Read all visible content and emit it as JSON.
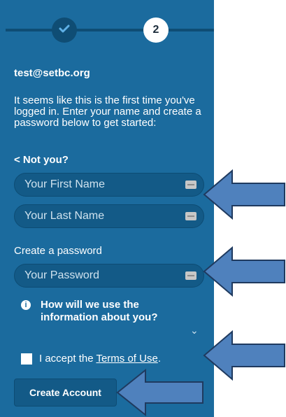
{
  "stepper": {
    "step1_icon": "check-icon",
    "step2_number": "2"
  },
  "account": {
    "email": "test@setbc.org",
    "intro": "It seems like this is the first time you've logged in. Enter your name and create a password below to get started:",
    "not_you": "< Not you?"
  },
  "form": {
    "first_name_placeholder": "Your First Name",
    "last_name_placeholder": "Your Last Name",
    "password_label": "Create a password",
    "password_placeholder": "Your Password",
    "info_text": "How will we use the information about you?",
    "accept_prefix": "I accept the ",
    "terms_link": "Terms of Use",
    "accept_suffix": ".",
    "create_button": "Create Account"
  },
  "colors": {
    "panel": "#1b6b9e",
    "field": "#135a87",
    "arrow_fill": "#4f81bd",
    "arrow_stroke": "#1f3a5f"
  }
}
